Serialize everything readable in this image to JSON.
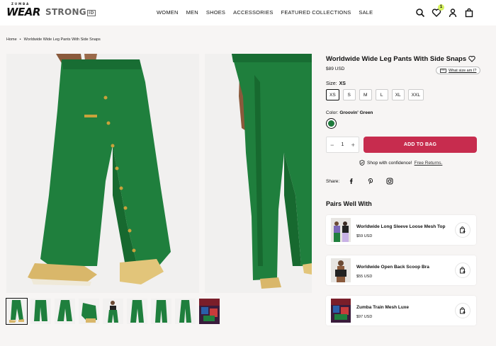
{
  "header": {
    "logo_small": "ZUMBA",
    "logo_wear": "WEAR",
    "logo_strong": "STRONG",
    "logo_strong_id": "ID",
    "nav": [
      "WOMEN",
      "MEN",
      "SHOES",
      "ACCESSORIES",
      "FEATURED COLLECTIONS",
      "SALE"
    ],
    "wishlist_count": "1"
  },
  "breadcrumb": {
    "home": "Home",
    "sep": "•",
    "current": "Worldwide Wide Leg Pants With Side Snaps"
  },
  "product": {
    "title": "Worldwide Wide Leg Pants With Side Snaps",
    "price": "$89 USD",
    "size_help": "What size am I?",
    "size_label": "Size:",
    "size_selected": "XS",
    "sizes": [
      "XS",
      "S",
      "M",
      "L",
      "XL",
      "XXL"
    ],
    "color_label": "Color:",
    "color_name": "Groovin' Green",
    "color_hex": "#1d7a3b",
    "qty": "1",
    "qty_minus": "−",
    "qty_plus": "+",
    "add_to_bag": "ADD TO BAG",
    "confidence": "Shop with confidence!",
    "returns": "Free Returns.",
    "share_label": "Share:"
  },
  "pairs": {
    "title": "Pairs Well With",
    "items": [
      {
        "name": "Worldwide Long Sleeve Loose Mesh Top",
        "price": "$59 USD"
      },
      {
        "name": "Worldwide Open Back Scoop Bra",
        "price": "$55 USD"
      },
      {
        "name": "Zumba Train Mesh Luxe",
        "price": "$97 USD"
      }
    ]
  },
  "colors": {
    "accent": "#c72c4e",
    "badge": "#d6f25e",
    "pants_green": "#1d7a3b"
  }
}
